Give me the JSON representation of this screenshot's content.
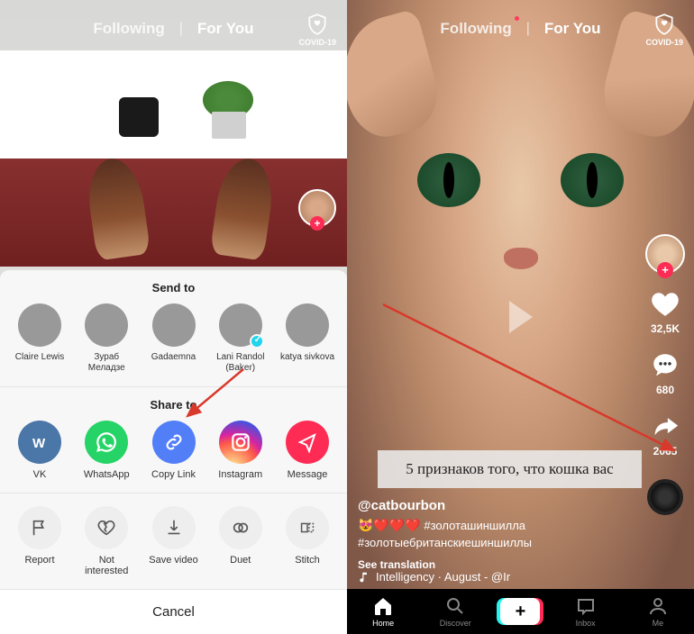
{
  "topnav": {
    "following": "Following",
    "foryou": "For You"
  },
  "covid": "COVID-19",
  "sheet": {
    "send_to": "Send to",
    "share_to": "Share to",
    "cancel": "Cancel",
    "contacts": [
      {
        "name": "Claire Lewis",
        "verified": false
      },
      {
        "name": "Зураб Меладзе",
        "verified": false
      },
      {
        "name": "Gadaemna",
        "verified": false
      },
      {
        "name": "Lani Randol (Baker)",
        "verified": true
      },
      {
        "name": "katya sivkova",
        "verified": false
      }
    ],
    "share": [
      {
        "label": "VK",
        "icon": "vk"
      },
      {
        "label": "WhatsApp",
        "icon": "wa"
      },
      {
        "label": "Copy Link",
        "icon": "cl"
      },
      {
        "label": "Instagram",
        "icon": "ig"
      },
      {
        "label": "Message",
        "icon": "msg"
      }
    ],
    "actions": [
      {
        "label": "Report",
        "icon": "flag"
      },
      {
        "label": "Not interested",
        "icon": "heart-broken"
      },
      {
        "label": "Save video",
        "icon": "download"
      },
      {
        "label": "Duet",
        "icon": "duet"
      },
      {
        "label": "Stitch",
        "icon": "stitch"
      }
    ]
  },
  "video": {
    "username": "@catbourbon",
    "caption_overlay": "5 признаков того, что кошка вас",
    "hashtags_emoji": "😻❤️❤️❤️",
    "hashtags": "#золоташиншилла #золотыебританскиешиншиллы",
    "see_translation": "See translation",
    "music": "Intelligency · August - @Ir",
    "likes": "32,5K",
    "comments": "680",
    "shares": "2065"
  },
  "bottombar": {
    "home": "Home",
    "discover": "Discover",
    "inbox": "Inbox",
    "me": "Me"
  }
}
